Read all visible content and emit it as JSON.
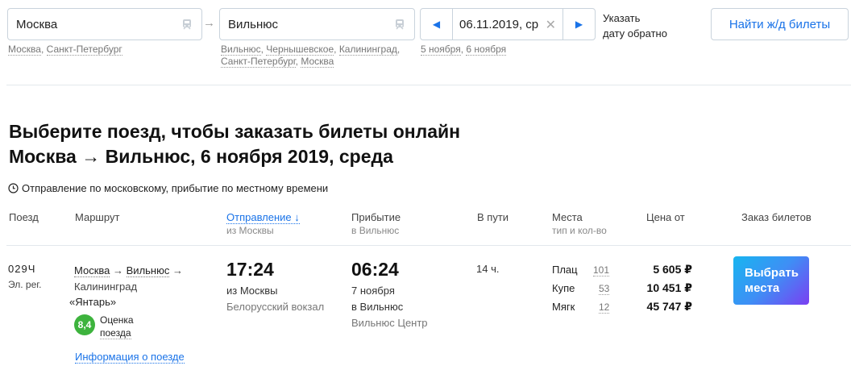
{
  "search": {
    "from_value": "Москва",
    "from_hints": [
      "Москва",
      "Санкт-Петербург"
    ],
    "to_value": "Вильнюс",
    "to_hints": [
      "Вильнюс",
      "Чернышевское",
      "Калининград",
      "Санкт-Петербург",
      "Москва"
    ],
    "date_value": "06.11.2019, ср",
    "date_hints": [
      "5 ноября",
      "6 ноября"
    ],
    "return_link_line1": "Указать",
    "return_link_line2": "дату обратно",
    "find_button": "Найти ж/д билеты"
  },
  "heading": {
    "line1": "Выберите поезд, чтобы заказать билеты онлайн",
    "line2": "Москва → Вильнюс, 6 ноября 2019, среда"
  },
  "timezone_note": "Отправление по московскому, прибытие по местному времени",
  "table_header": {
    "train": "Поезд",
    "route": "Маршрут",
    "departure": "Отправление ↓",
    "departure_sub": "из Москвы",
    "arrival": "Прибытие",
    "arrival_sub": "в Вильнюс",
    "duration": "В пути",
    "seats": "Места",
    "seats_sub": "тип и кол-во",
    "price": "Цена от",
    "order": "Заказ билетов"
  },
  "train": {
    "number": "029Ч",
    "kind": "Эл. рег.",
    "route_from": "Москва",
    "route_to": "Вильнюс",
    "route_final": "Калининград",
    "brand": "«Янтарь»",
    "rating": "8,4",
    "rating_label_line1": "Оценка",
    "rating_label_line2": "поезда",
    "info_link": "Информация о поезде",
    "departure_time": "17:24",
    "departure_from": "из Москвы",
    "departure_station": "Белорусский вокзал",
    "arrival_time": "06:24",
    "arrival_date": "7 ноября",
    "arrival_to": "в Вильнюс",
    "arrival_station": "Вильнюс Центр",
    "duration": "14 ч.",
    "seats": [
      {
        "type": "Плац",
        "count": "101",
        "price": "5 605 ₽"
      },
      {
        "type": "Купе",
        "count": "53",
        "price": "10 451 ₽"
      },
      {
        "type": "Мягк",
        "count": "12",
        "price": "45 747 ₽"
      }
    ],
    "choose_button_line1": "Выбрать",
    "choose_button_line2": "места"
  },
  "colors": {
    "accent": "#1a73e8",
    "rating_green": "#3db33d",
    "button_gradient_start": "#18b5f0",
    "button_gradient_end": "#7a3ff2"
  }
}
